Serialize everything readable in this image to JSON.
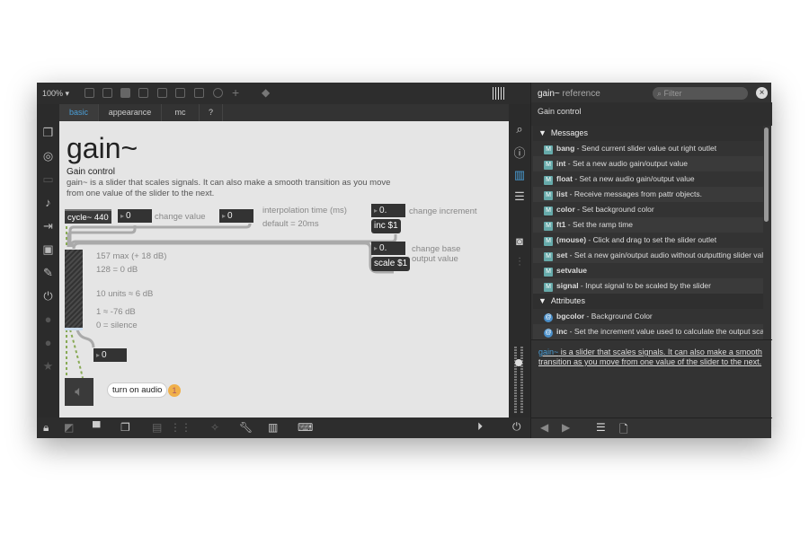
{
  "toolbar": {
    "zoom": "100%"
  },
  "tabs": [
    "basic",
    "appearance",
    "mc",
    "?"
  ],
  "patch": {
    "title": "gain~",
    "subtitle": "Gain control",
    "description": "gain~ is a slider that scales signals. It can also make a smooth transition as you move from one value of the slider to the next.",
    "cycle": "cycle~ 440",
    "num_value": "0",
    "change_value": "change value",
    "num_interp": "0",
    "interp_label": "interpolation time (ms)",
    "interp_default": "default = 20ms",
    "num_inc": "0.",
    "inc_msg": "inc $1",
    "inc_label": "change increment",
    "num_scale": "0.",
    "scale_msg": "scale $1",
    "scale_label1": "change base",
    "scale_label2": "output value",
    "notes": [
      "157 max (+ 18 dB)",
      "128 = 0 dB",
      "10 units ≈ 6 dB",
      "1 ≈ -76 dB",
      "0 = silence"
    ],
    "num_out": "0",
    "audio_label": "turn on audio",
    "step": "1"
  },
  "reference": {
    "object": "gain~",
    "title": "reference",
    "filter_placeholder": "Filter",
    "summary": "Gain control",
    "messages_header": "Messages",
    "messages": [
      {
        "name": "bang",
        "desc": " - Send current slider value out right outlet"
      },
      {
        "name": "int",
        "desc": " - Set a new audio gain/output value"
      },
      {
        "name": "float",
        "desc": " - Set a new audio gain/output value"
      },
      {
        "name": "list",
        "desc": " - Receive messages from pattr objects."
      },
      {
        "name": "color",
        "desc": " - Set background color"
      },
      {
        "name": "ft1",
        "desc": " - Set the ramp time"
      },
      {
        "name": "(mouse)",
        "desc": " - Click and drag to set the slider outlet"
      },
      {
        "name": "set",
        "desc": " - Set a new gain/output audio without outputting slider value"
      },
      {
        "name": "setvalue",
        "desc": ""
      },
      {
        "name": "signal",
        "desc": " - Input signal to be scaled by the slider"
      }
    ],
    "attributes_header": "Attributes",
    "attributes": [
      {
        "name": "bgcolor",
        "desc": " - Background Color"
      },
      {
        "name": "inc",
        "desc": " - Set the increment value used to calculate the output scale fac..."
      }
    ],
    "footer_link": "gain~",
    "footer_text": " is a slider that scales signals. It can also make a smooth transition as you move from one value of the slider to the next."
  },
  "colors": {
    "accent": "#4a9fd8",
    "badge": "#f0b04a"
  }
}
